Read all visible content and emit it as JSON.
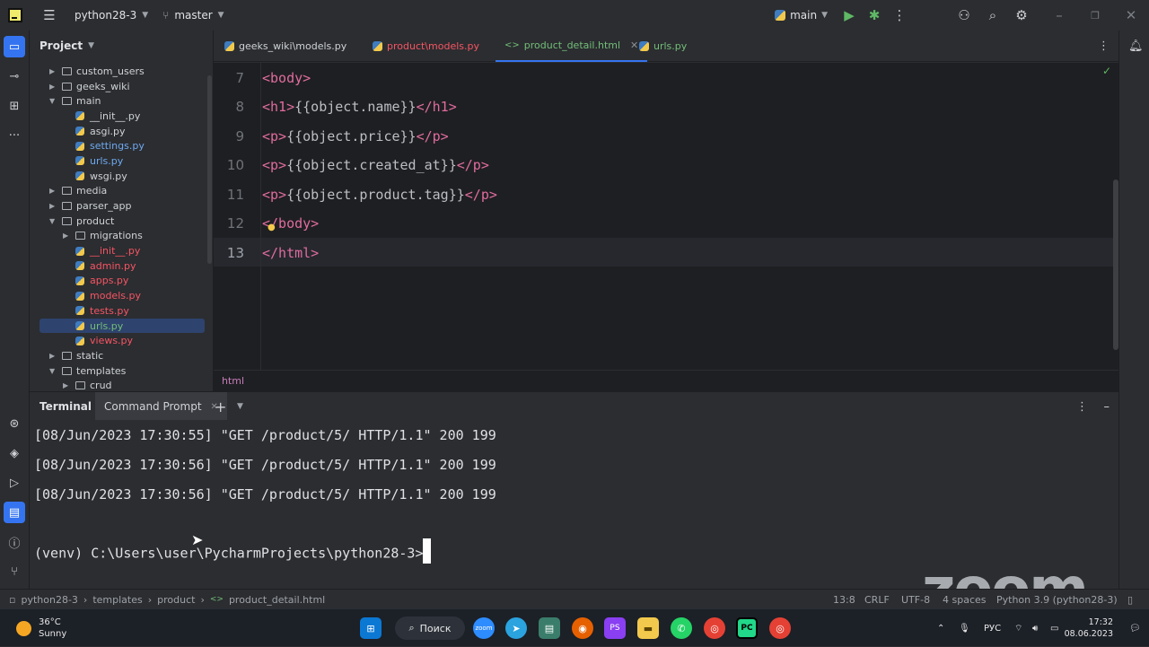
{
  "titlebar": {
    "project_name": "python28-3",
    "branch": "master",
    "run_config": "main"
  },
  "project_panel": {
    "title": "Project",
    "tree": [
      {
        "label": "custom_users",
        "type": "folder",
        "depth": 1,
        "expanded": false,
        "color": "default"
      },
      {
        "label": "geeks_wiki",
        "type": "folder",
        "depth": 1,
        "expanded": false,
        "color": "default"
      },
      {
        "label": "main",
        "type": "folder",
        "depth": 1,
        "expanded": true,
        "color": "default"
      },
      {
        "label": "__init__.py",
        "type": "file",
        "depth": 2,
        "color": "default"
      },
      {
        "label": "asgi.py",
        "type": "file",
        "depth": 2,
        "color": "default"
      },
      {
        "label": "settings.py",
        "type": "file",
        "depth": 2,
        "color": "blue"
      },
      {
        "label": "urls.py",
        "type": "file",
        "depth": 2,
        "color": "blue"
      },
      {
        "label": "wsgi.py",
        "type": "file",
        "depth": 2,
        "color": "default"
      },
      {
        "label": "media",
        "type": "folder",
        "depth": 1,
        "expanded": false,
        "color": "default"
      },
      {
        "label": "parser_app",
        "type": "folder",
        "depth": 1,
        "expanded": false,
        "color": "default"
      },
      {
        "label": "product",
        "type": "folder",
        "depth": 1,
        "expanded": true,
        "color": "default"
      },
      {
        "label": "migrations",
        "type": "folder",
        "depth": 2,
        "expanded": false,
        "color": "default"
      },
      {
        "label": "__init__.py",
        "type": "file",
        "depth": 2,
        "color": "red"
      },
      {
        "label": "admin.py",
        "type": "file",
        "depth": 2,
        "color": "red"
      },
      {
        "label": "apps.py",
        "type": "file",
        "depth": 2,
        "color": "red"
      },
      {
        "label": "models.py",
        "type": "file",
        "depth": 2,
        "color": "red"
      },
      {
        "label": "tests.py",
        "type": "file",
        "depth": 2,
        "color": "red"
      },
      {
        "label": "urls.py",
        "type": "file",
        "depth": 2,
        "color": "green",
        "selected": true
      },
      {
        "label": "views.py",
        "type": "file",
        "depth": 2,
        "color": "red"
      },
      {
        "label": "static",
        "type": "folder",
        "depth": 1,
        "expanded": false,
        "color": "default"
      },
      {
        "label": "templates",
        "type": "folder",
        "depth": 1,
        "expanded": true,
        "color": "default"
      },
      {
        "label": "crud",
        "type": "folder",
        "depth": 2,
        "expanded": false,
        "color": "default"
      }
    ]
  },
  "tabs": [
    {
      "label": "geeks_wiki\\models.py",
      "color": "#cfd2d6",
      "icon": "python-file-icon"
    },
    {
      "label": "product\\models.py",
      "color": "#f75464",
      "icon": "python-file-icon"
    },
    {
      "label": "product_detail.html",
      "color": "#73bd79",
      "icon": "html-file-icon",
      "active": true
    },
    {
      "label": "urls.py",
      "color": "#73bd79",
      "icon": "python-file-icon"
    }
  ],
  "editor": {
    "line_numbers": [
      "7",
      "8",
      "9",
      "10",
      "11",
      "12",
      "13"
    ],
    "lines": [
      {
        "open": "<body>",
        "content": "",
        "close": ""
      },
      {
        "open": "<h1>",
        "content": "{{object.name}}",
        "close": "</h1>"
      },
      {
        "open": "<p>",
        "content": "{{object.price}}",
        "close": "</p>"
      },
      {
        "open": "<p>",
        "content": "{{object.created_at}}",
        "close": "</p>"
      },
      {
        "open": "<p>",
        "content": "{{object.product.tag}}",
        "close": "</p>"
      },
      {
        "open": "</body>",
        "content": "",
        "close": ""
      },
      {
        "open": "</html>",
        "content": "",
        "close": ""
      }
    ],
    "breadcrumb": "html"
  },
  "terminal": {
    "tab_label": "Terminal",
    "session_label": "Command Prompt",
    "lines": [
      "[08/Jun/2023 17:30:55] \"GET /product/5/ HTTP/1.1\" 200 199",
      "[08/Jun/2023 17:30:56] \"GET /product/5/ HTTP/1.1\" 200 199",
      "[08/Jun/2023 17:30:56] \"GET /product/5/ HTTP/1.1\" 200 199"
    ],
    "prompt": "(venv) C:\\Users\\user\\PycharmProjects\\python28-3>"
  },
  "statusbar": {
    "crumbs": [
      "python28-3",
      "templates",
      "product",
      "product_detail.html"
    ],
    "position": "13:8",
    "line_ending": "CRLF",
    "encoding": "UTF-8",
    "indent": "4 spaces",
    "interpreter": "Python 3.9 (python28-3)"
  },
  "watermark": "zoom",
  "taskbar": {
    "temperature": "36°C",
    "weather": "Sunny",
    "search_label": "Поиск",
    "language": "РУС",
    "time": "17:32",
    "date": "08.06.2023"
  }
}
